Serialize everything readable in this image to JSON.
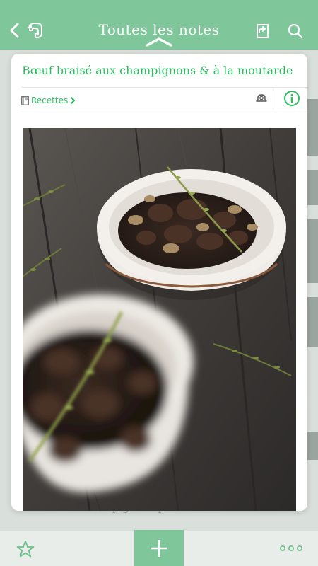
{
  "header": {
    "title": "Toutes les notes",
    "icons": {
      "back": "chevron-left-icon",
      "logo": "evernote-elephant-icon",
      "share": "share-icon",
      "search": "search-icon",
      "collapse": "chevron-up-icon"
    }
  },
  "note": {
    "title": "Bœuf braisé aux champignons & à la moutarde",
    "notebook": "Recettes",
    "icons": {
      "notebook": "notebook-icon",
      "chevron": "chevron-right-icon",
      "reminder": "reminder-icon",
      "info": "info-icon"
    },
    "image": "braised-beef-mushroom-bowls-photo"
  },
  "background_list": {
    "partial_text": "Bœuf   aux  champignons   p..."
  },
  "toolbar": {
    "icons": {
      "star": "star-icon",
      "add": "plus-icon",
      "more": "more-dots-icon"
    }
  },
  "colors": {
    "accent": "#2dbe60",
    "header_green": "#7fc79a"
  }
}
